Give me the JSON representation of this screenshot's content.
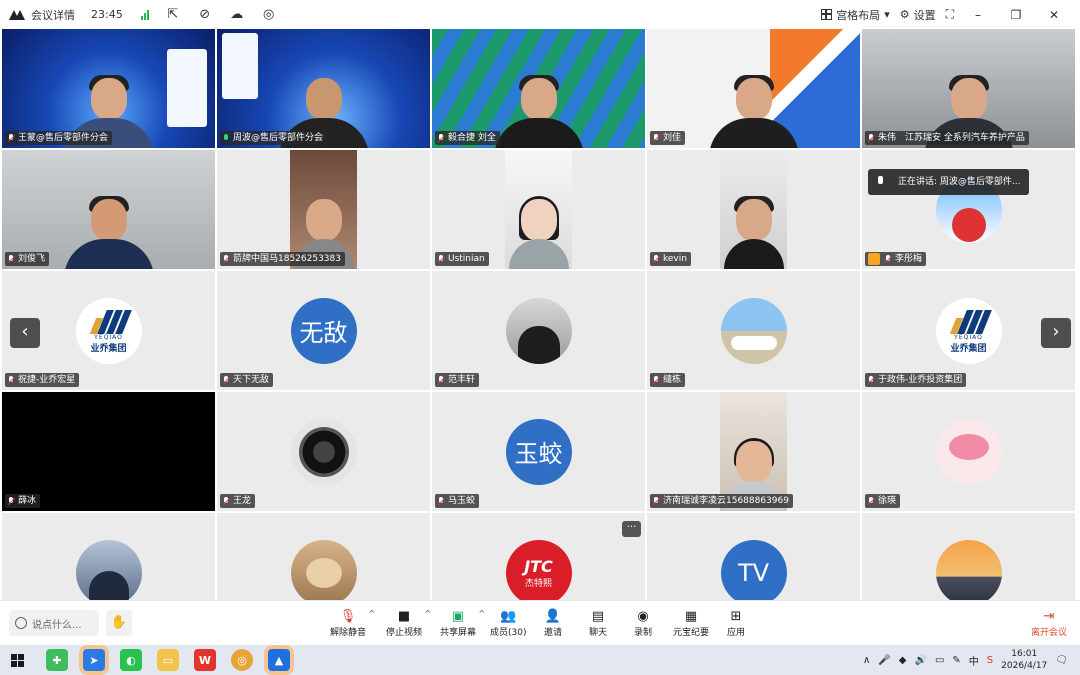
{
  "titlebar": {
    "title": "会议详情",
    "time": "23:45",
    "layout_label": "宫格布局",
    "settings_label": "设置",
    "minimize": "–",
    "maximize": "❐",
    "close": "✕"
  },
  "speaking": {
    "prefix": "正在讲话:",
    "name": "周波@售后零部件..."
  },
  "tiles": [
    {
      "name": "王蒙@售后零部件分会",
      "kind": "banner"
    },
    {
      "name": "周波@售后零部件分会",
      "kind": "banner-active",
      "mic_on": true
    },
    {
      "name": "毅合捷 刘全",
      "kind": "green"
    },
    {
      "name": "刘佳",
      "kind": "office"
    },
    {
      "name": "朱伟　江苏瑞安 全系列汽车养护产品",
      "kind": "window"
    },
    {
      "name": "刘俊飞",
      "kind": "car"
    },
    {
      "name": "箭牌中国马18526253383",
      "kind": "portrait"
    },
    {
      "name": "Ustinian",
      "kind": "portrait-girl"
    },
    {
      "name": "kevin",
      "kind": "portrait-man"
    },
    {
      "name": "李彤梅",
      "kind": "avatar-red",
      "host": true
    },
    {
      "name": "祝捷-业乔宏星",
      "kind": "logo-yq"
    },
    {
      "name": "天下无敌",
      "kind": "text-avatar",
      "avatar_text": "无敌"
    },
    {
      "name": "范丰轩",
      "kind": "avatar-suit"
    },
    {
      "name": "缱栋",
      "kind": "avatar-car"
    },
    {
      "name": "于政伟-业乔投资集团",
      "kind": "logo-yq"
    },
    {
      "name": "薛冰",
      "kind": "black"
    },
    {
      "name": "王龙",
      "kind": "avatar-lens"
    },
    {
      "name": "马玉蛟",
      "kind": "text-avatar",
      "avatar_text": "玉蛟"
    },
    {
      "name": "济南瑞诚李凌云15688863969",
      "kind": "portrait-woman"
    },
    {
      "name": "徐瑛",
      "kind": "avatar-flower"
    },
    {
      "name": "",
      "kind": "avatar-man2"
    },
    {
      "name": "",
      "kind": "avatar-cat"
    },
    {
      "name": "",
      "kind": "avatar-jtc",
      "avatar_text": "JTC",
      "avatar_sub": "杰特熙"
    },
    {
      "name": "",
      "kind": "text-avatar",
      "avatar_text": "TV"
    },
    {
      "name": "",
      "kind": "avatar-sunset"
    }
  ],
  "yq_logo": {
    "sub": "YEQIAO",
    "name": "业乔集团"
  },
  "toolbar": {
    "chat_placeholder": "说点什么...",
    "unmute": "解除静音",
    "stop_video": "停止视频",
    "share": "共享屏幕",
    "members": "成员(30)",
    "invite": "邀请",
    "chat": "聊天",
    "record": "录制",
    "ai_notes": "元宝纪要",
    "apps": "应用",
    "leave": "离开会议"
  },
  "taskbar": {
    "time": "16:01",
    "date": "2026/4/17",
    "ime": "中"
  },
  "colors": {
    "active_outline": "#2fd6a3",
    "avatar_blue": "#2f6fc5",
    "leave_red": "#e0472e"
  }
}
